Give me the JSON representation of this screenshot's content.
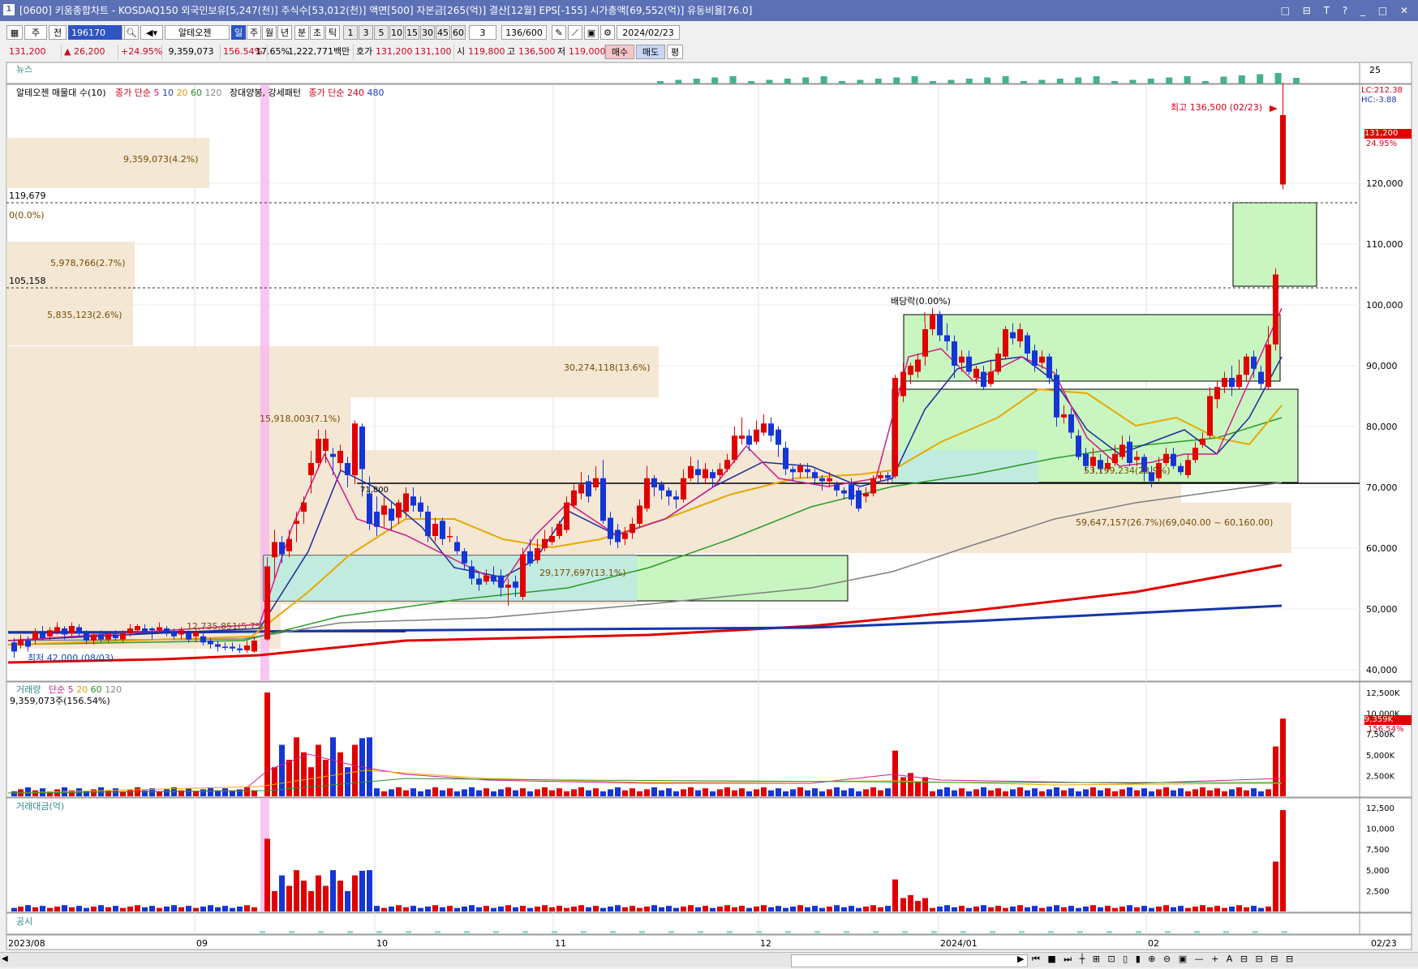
{
  "title_bar": {
    "icon": "1",
    "text": "[0600] 키움종합차트 - KOSDAQ150 외국인보유[5,247(천)] 주식수[53,012(천)] 액면[500] 자본금[265(억)] 결산[12월] EPS[-155] 시가총액[69,552(억)] 유동비율[76.0]",
    "window_buttons": "□ ⊟ T ? _ □ ✕"
  },
  "toolbar": {
    "juk": "주",
    "jeon": "전",
    "code": "196170",
    "stock_name": "알테오젠",
    "periods": [
      "일",
      "주",
      "월",
      "년",
      "분",
      "초",
      "틱"
    ],
    "minutes": [
      "1",
      "3",
      "5",
      "10",
      "15",
      "30",
      "45",
      "60"
    ],
    "count_sel": "3",
    "range": "136/600",
    "date": "2024/02/23"
  },
  "quote_bar": {
    "price": "131,200",
    "change": "▲ 26,200",
    "rate": "+24.95%",
    "volume": "9,359,073",
    "vol_rate": "156.54%",
    "turnover": "17.65%",
    "amount": "1,222,771백만",
    "ask_label": "호가",
    "ask": "131,200",
    "bid": "131,100",
    "open_label": "시",
    "open": "119,800",
    "high_label": "고",
    "high": "136,500",
    "low_label": "저",
    "low": "119,000",
    "buy": "매수",
    "sell": "매도",
    "flat": "평"
  },
  "panels": {
    "news": "뉴스",
    "news_scale": "25",
    "price_title": "알테오젠 매물대 수(10)",
    "ma_label": "종가 단순",
    "ma_periods": [
      "5",
      "10",
      "20",
      "60",
      "120"
    ],
    "pattern": "장대양봉, 강세패턴",
    "ma2_label": "종가 단순",
    "ma2_periods": [
      "240",
      "480"
    ],
    "lc": "LC:212.38",
    "hc": "HC:-3.88",
    "high_note": "최고 136,500 (02/23)",
    "low_note": "최저 42,000 (08/03)",
    "dividend": "배당락(0.00%)",
    "cur_price_tag": "131,200",
    "cur_rate_tag": "24.95%",
    "line_119": "119,679",
    "line_105": "105,158",
    "zero_label": "0(0.0%)",
    "num_71800": "71,800",
    "volume_title": "거래량",
    "vol_ma_label": "단순",
    "vol_ma_periods": [
      "5",
      "20",
      "60",
      "120"
    ],
    "vol_value": "9,359,073주(156.54%)",
    "vol_tag1": "9,359K",
    "vol_tag2": "156.54%",
    "amount_title": "거래대금(억)",
    "disclosure": "공시"
  },
  "y_axis_price": [
    "120,000",
    "110,000",
    "100,000",
    "90,000",
    "80,000",
    "70,000",
    "60,000",
    "50,000",
    "40,000"
  ],
  "y_axis_volume": [
    "12,500K",
    "10,000K",
    "7,500K",
    "5,000K",
    "2,500K"
  ],
  "y_axis_amount": [
    "12,500",
    "10,000",
    "7,500",
    "5,000",
    "2,500"
  ],
  "x_axis": [
    "2023/08",
    "09",
    "10",
    "11",
    "12",
    "2024/01",
    "02",
    "02/23"
  ],
  "volume_profile": [
    {
      "label": "9,359,073(4.2%)"
    },
    {
      "label": "5,978,766(2.7%)"
    },
    {
      "label": "5,835,123(2.6%)"
    },
    {
      "label": "30,274,118(13.6%)"
    },
    {
      "label": "15,918,003(7.1%)"
    },
    {
      "label": "53,199,234(23.9%)"
    },
    {
      "label": "59,647,157(26.7%)(69,040.00 ~ 60,160.00)"
    },
    {
      "label": "29,177,697(13.1%)"
    },
    {
      "label": "12,735,851(5.7%)"
    }
  ],
  "colors": {
    "up": "#e00000",
    "down": "#1535d6",
    "ma5": "#d01c8b",
    "ma10": "#1a2a9a",
    "ma20": "#e8a800",
    "ma60": "#2a9a2a",
    "ma120": "#7f7f7f",
    "ma240": "#e00000",
    "ma480": "#1535a8",
    "box": "#c9f5c0",
    "title": "#5b70b5"
  }
}
